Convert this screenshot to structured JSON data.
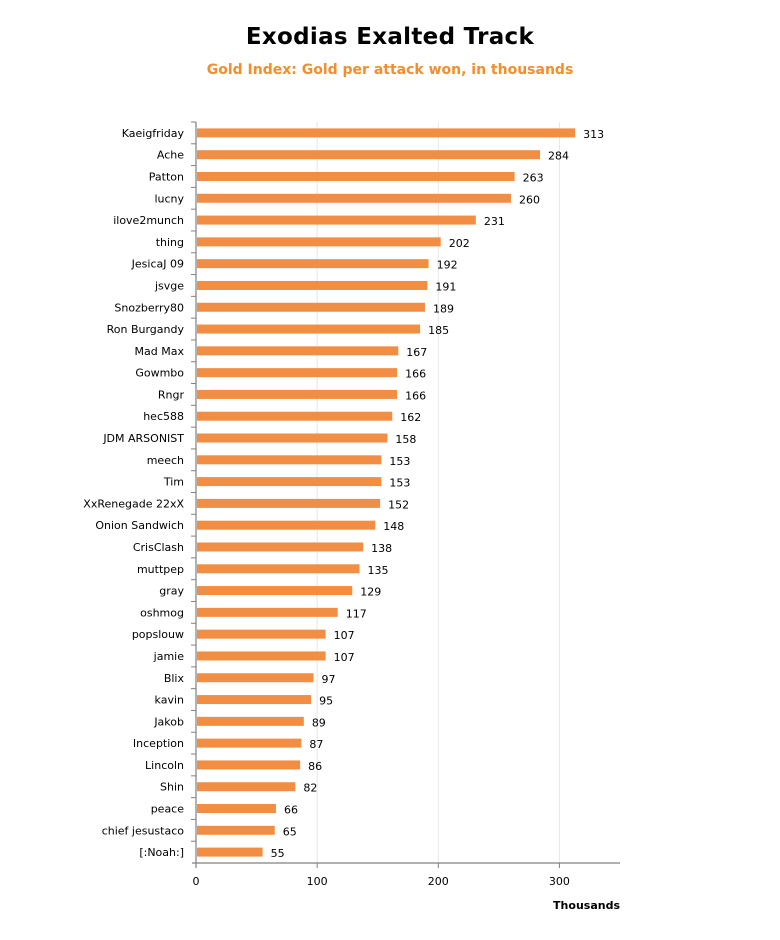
{
  "chart_data": {
    "type": "bar",
    "orientation": "horizontal",
    "title": "Exodias Exalted Track",
    "subtitle": "Gold Index: Gold per attack won, in thousands",
    "xlabel": "Thousands",
    "ylabel": "",
    "xlim": [
      0,
      350
    ],
    "xticks": [
      0,
      100,
      200,
      300
    ],
    "grid": true,
    "legend": "none",
    "bar_color": "#F28E43",
    "categories": [
      "Kaeigfriday",
      "Ache",
      "Patton",
      "lucny",
      "ilove2munch",
      "thing",
      "JesicaJ 09",
      "jsvge",
      "Snozberry80",
      "Ron Burgandy",
      "Mad Max",
      "Gowmbo",
      "Rngr",
      "hec588",
      "JDM ARSONIST",
      "meech",
      "Tim",
      "XxRenegade 22xX",
      "Onion Sandwich",
      "CrisClash",
      "muttpep",
      "gray",
      "oshmog",
      "popslouw",
      "jamie",
      "Blix",
      "kavin",
      "Jakob",
      "Inception",
      "Lincoln",
      "Shin",
      "peace",
      "chief jesustaco",
      "[:Noah:]"
    ],
    "values": [
      313,
      284,
      263,
      260,
      231,
      202,
      192,
      191,
      189,
      185,
      167,
      166,
      166,
      162,
      158,
      153,
      153,
      152,
      148,
      138,
      135,
      129,
      117,
      107,
      107,
      97,
      95,
      89,
      87,
      86,
      82,
      66,
      65,
      55
    ]
  }
}
